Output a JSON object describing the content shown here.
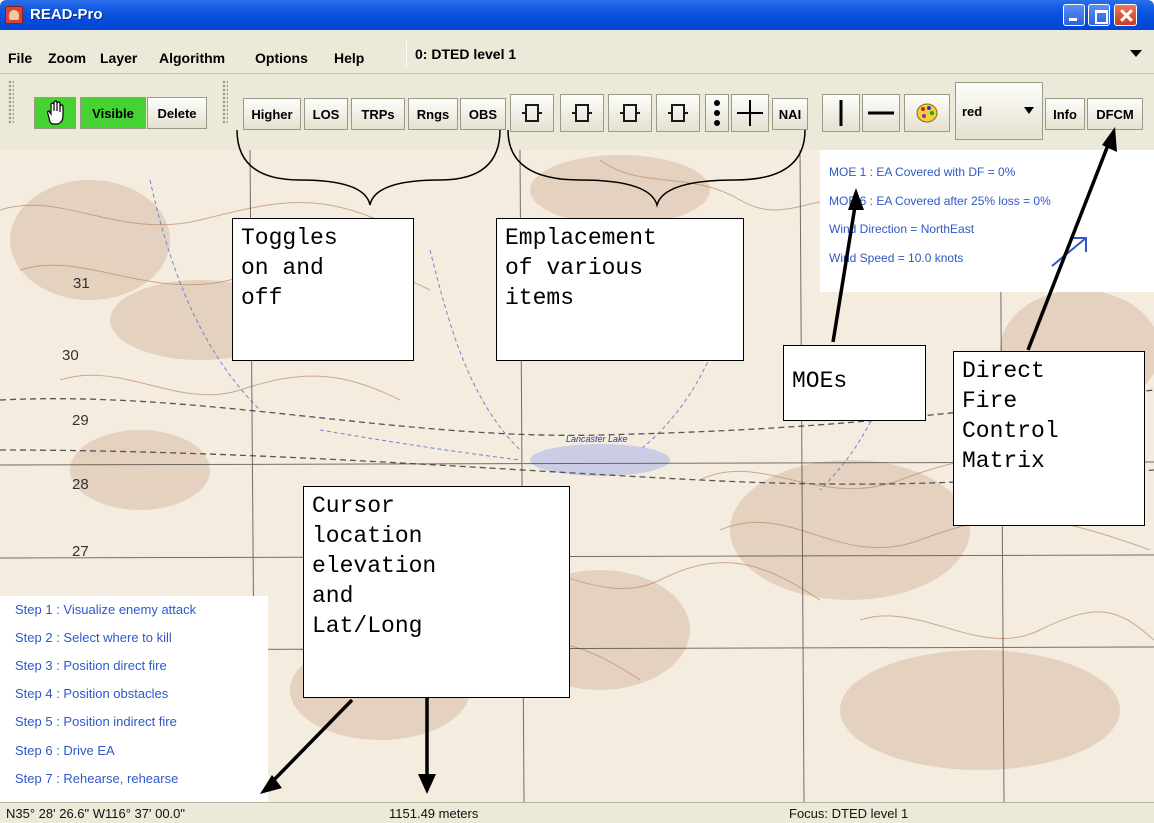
{
  "window": {
    "title": "READ-Pro"
  },
  "menu": {
    "items": [
      "File",
      "Zoom",
      "Layer",
      "Algorithm",
      "Options",
      "Help"
    ],
    "layer_select_value": "0: DTED level 1"
  },
  "toolbar": {
    "group1": {
      "hand_icon": "hand-icon",
      "visible_label": "Visible",
      "delete_label": "Delete"
    },
    "toggles": [
      "Higher",
      "LOS",
      "TRPs",
      "Rngs",
      "OBS"
    ],
    "emplacement_icons": [
      "emplacement-icon",
      "emplacement-icon",
      "emplacement-icon",
      "emplacement-icon"
    ],
    "nai_label": "NAI",
    "color_select_value": "red",
    "info_label": "Info",
    "dfcm_label": "DFCM"
  },
  "moe": {
    "lines": [
      "MOE 1 : EA Covered with DF = 0%",
      "MOE 6 : EA Covered after 25% loss =  0%",
      "Wind Direction = NorthEast",
      "Wind Speed = 10.0 knots"
    ],
    "wind_arrow_color": "#2f58c8"
  },
  "map": {
    "grid_labels": [
      "31",
      "30",
      "29",
      "28",
      "27"
    ],
    "place_labels": [
      "Lancaster Lake"
    ]
  },
  "steps": [
    "Step 1 :  Visualize enemy attack",
    "Step 2 :  Select where to kill",
    "Step 3 :  Position direct fire",
    "Step 4 :  Position obstacles",
    "Step 5 :  Position indirect fire",
    "Step 6 :  Drive EA",
    "Step 7 :  Rehearse, rehearse"
  ],
  "status": {
    "latlong": "N35° 28' 26.6\"  W116° 37' 00.0\"",
    "elevation": "1151.49 meters",
    "focus": "Focus:  DTED level 1"
  },
  "callouts": {
    "toggles": "Toggles\non and\noff",
    "emplacement": "Emplacement\nof various\nitems",
    "moes": "MOEs",
    "dfcm": "Direct\nFire\nControl\nMatrix",
    "cursor": "Cursor\nlocation\nelevation\nand\nLat/Long"
  }
}
